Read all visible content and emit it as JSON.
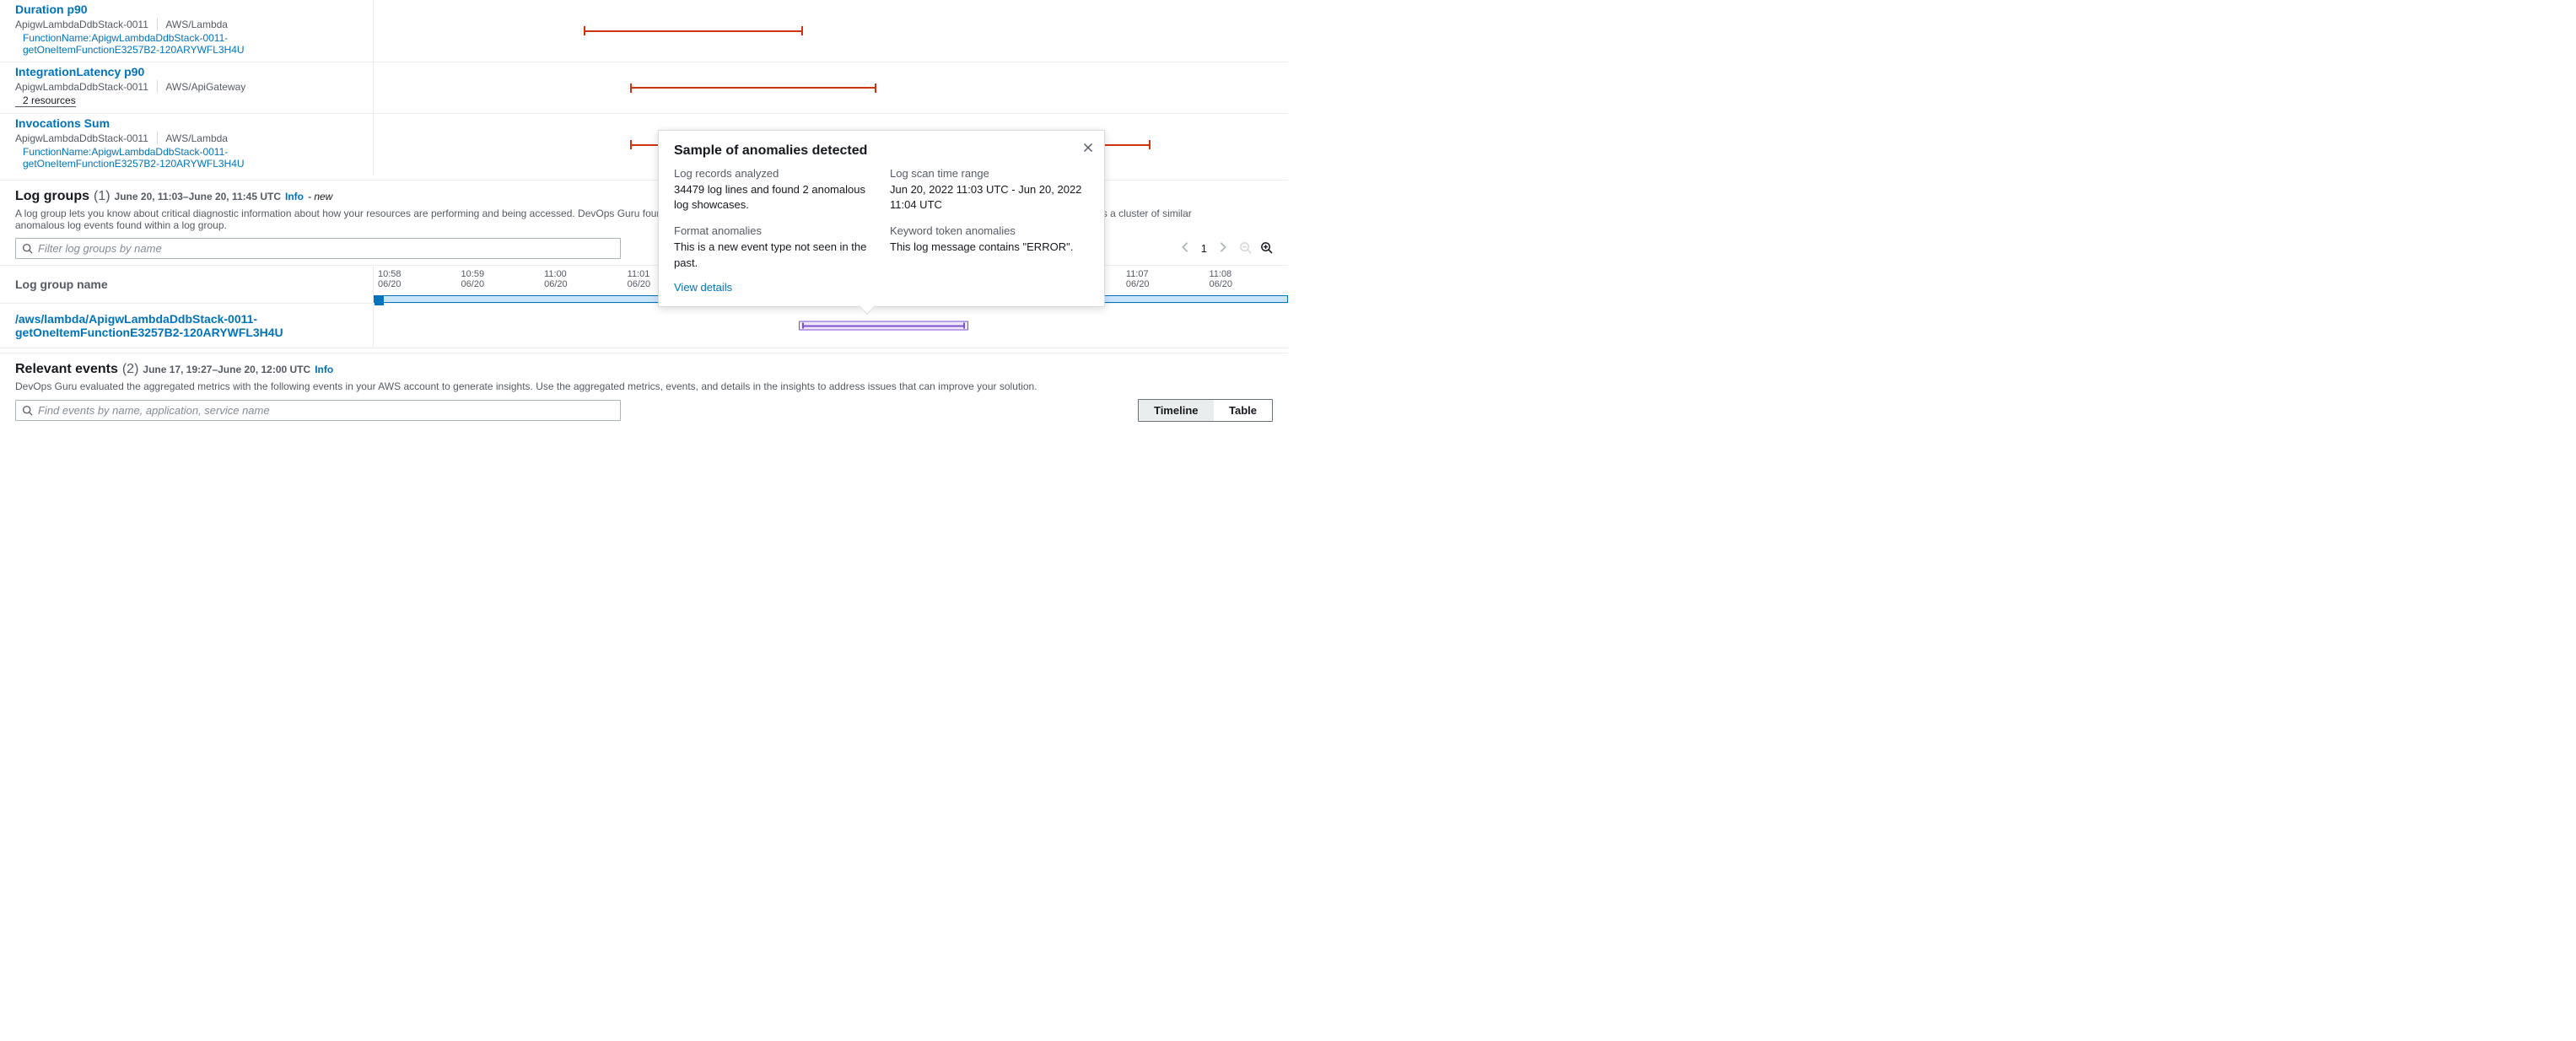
{
  "anomalies": [
    {
      "title": "Duration p90",
      "stack": "ApigwLambdaDdbStack-0011",
      "namespace": "AWS/Lambda",
      "function": "FunctionName:ApigwLambdaDdbStack-0011-getOneItemFunctionE3257B2-120ARYWFL3H4U",
      "bar_left": "23%",
      "bar_width": "24%"
    },
    {
      "title": "IntegrationLatency p90",
      "stack": "ApigwLambdaDdbStack-0011",
      "namespace": "AWS/ApiGateway",
      "resources": "2 resources",
      "bar_left": "28%",
      "bar_width": "27%"
    },
    {
      "title": "Invocations Sum",
      "stack": "ApigwLambdaDdbStack-0011",
      "namespace": "AWS/Lambda",
      "function": "FunctionName:ApigwLambdaDdbStack-0011-getOneItemFunctionE3257B2-120ARYWFL3H4U",
      "bar_left": "28%",
      "bar_width": "57%"
    }
  ],
  "log_groups": {
    "title": "Log groups",
    "count": "(1)",
    "daterange": "June 20, 11:03–June 20, 11:45 UTC",
    "info": "Info",
    "new": "- new",
    "description": "A log group lets you know about critical diagnostic information about how your resources are performing and being accessed. DevOps Guru found anomalous behavior in these log groups organized by log showcases. Each showcase represents a cluster of similar anomalous log events found within a log group.",
    "search_placeholder": "Filter log groups by name",
    "page": "1",
    "header": "Log group name",
    "ticks": [
      {
        "time": "10:58",
        "date": "06/20"
      },
      {
        "time": "10:59",
        "date": "06/20"
      },
      {
        "time": "11:00",
        "date": "06/20"
      },
      {
        "time": "11:01",
        "date": "06/20"
      },
      {
        "time": "",
        "date": ""
      },
      {
        "time": "",
        "date": ""
      },
      {
        "time": "",
        "date": ""
      },
      {
        "time": "",
        "date": ""
      },
      {
        "time": "",
        "date": ""
      },
      {
        "time": "11:07",
        "date": "06/20"
      },
      {
        "time": "11:08",
        "date": "06/20"
      }
    ],
    "row_link": "/aws/lambda/ApigwLambdaDdbStack-0011-getOneItemFunctionE3257B2-120ARYWFL3H4U"
  },
  "popover": {
    "title": "Sample of anomalies detected",
    "records_label": "Log records analyzed",
    "records_value": "34479 log lines and found 2 anomalous log showcases.",
    "scan_label": "Log scan time range",
    "scan_value": "Jun 20, 2022 11:03 UTC - Jun 20, 2022 11:04 UTC",
    "format_label": "Format anomalies",
    "format_value": "This is a new event type not seen in the past.",
    "keyword_label": "Keyword token anomalies",
    "keyword_value": "This log message contains \"ERROR\".",
    "view_details": "View details"
  },
  "events": {
    "title": "Relevant events",
    "count": "(2)",
    "daterange": "June 17, 19:27–June 20, 12:00 UTC",
    "info": "Info",
    "description": "DevOps Guru evaluated the aggregated metrics with the following events in your AWS account to generate insights. Use the aggregated metrics, events, and details in the insights to address issues that can improve your solution.",
    "search_placeholder": "Find events by name, application, service name",
    "toggle_timeline": "Timeline",
    "toggle_table": "Table"
  }
}
